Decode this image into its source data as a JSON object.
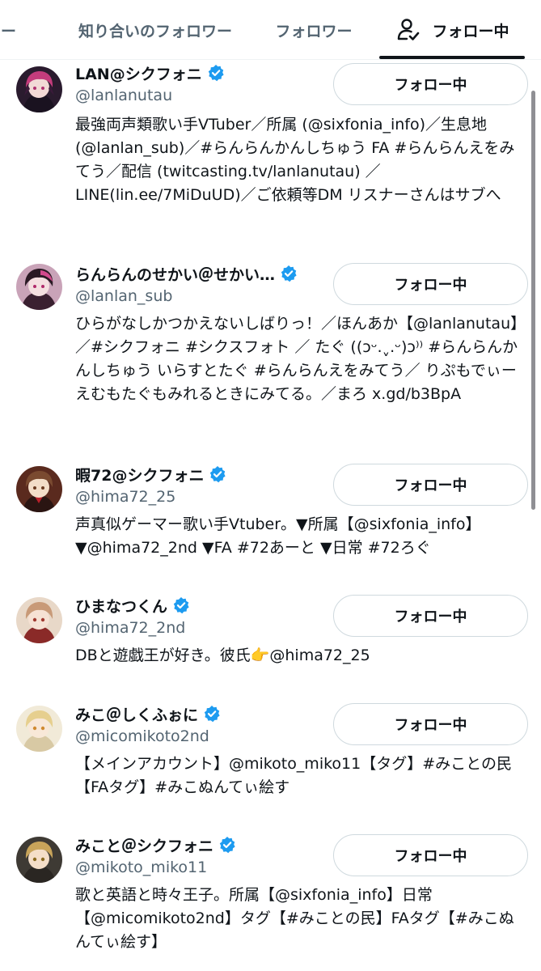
{
  "tabs": [
    {
      "label": "ワー",
      "active": false
    },
    {
      "label": "知り合いのフォロワー",
      "active": false
    },
    {
      "label": "フォロワー",
      "active": false
    },
    {
      "label": "フォロー中",
      "active": true,
      "icon": "person-check-icon"
    }
  ],
  "colors": {
    "verified": "#1d9bf0",
    "handle": "#536471",
    "text": "#0f1419",
    "button_border": "#cfd9de"
  },
  "users": [
    {
      "name": "LAN@シクフォニ",
      "verified": true,
      "handle": "@lanlanutau",
      "button": "フォロー中",
      "bio": "最強両声類歌い手VTuber／所属 (@sixfonia_info)／生息地 (@lanlan_sub)／#らんらんかんしちゅう FA #らんらんえをみてう／配信 (twitcasting.tv/lanlanutau) ／LINE(lin.ee/7MiDuUD)／ご依頼等DM リスナーさんはサブへ"
    },
    {
      "name": "らんらんのせかい＠せかい…",
      "verified": true,
      "handle": "@lanlan_sub",
      "button": "フォロー中",
      "bio": "ひらがなしかつかえないしばりっ！／ほんあか【@lanlanutau】／#シクフォニ #シクスフォト ／ たぐ ((ɔᵕ.ˬ.ᵕ)ɔ⁾⁾ #らんらんかんしちゅう いらすとたぐ #らんらんえをみてう／ りぷもでぃーえむもたぐもみれるときにみてる。／まろ x.gd/b3BpA"
    },
    {
      "name": "暇72@シクフォニ",
      "verified": true,
      "handle": "@hima72_25",
      "button": "フォロー中",
      "bio": "声真似ゲーマー歌い手Vtuber。▼所属【@sixfonia_info】▼@hima72_2nd ▼FA #72あーと ▼日常 #72ろぐ"
    },
    {
      "name": "ひまなつくん",
      "verified": true,
      "handle": "@hima72_2nd",
      "button": "フォロー中",
      "bio": "DBと遊戯王が好き。彼氏👉@hima72_25"
    },
    {
      "name": "みこ＠しくふぉに",
      "verified": true,
      "handle": "@micomikoto2nd",
      "button": "フォロー中",
      "bio": "【メインアカウント】@mikoto_miko11【タグ】#みことの民【FAタグ】#みこぬんてぃ絵す"
    },
    {
      "name": "みこと＠シクフォニ",
      "verified": true,
      "handle": "@mikoto_miko11",
      "button": "フォロー中",
      "bio": "歌と英語と時々王子。所属【@sixfonia_info】日常【@micomikoto2nd】タグ【#みことの民】FAタグ【#みこぬんてぃ絵す】"
    }
  ]
}
